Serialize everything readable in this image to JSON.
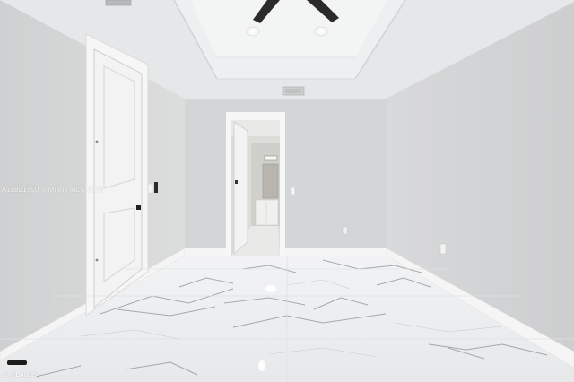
{
  "photo": {
    "watermark_text": "A11821750 © Miami MLS 2025",
    "brand_text": "SWFLAMLS"
  },
  "colors": {
    "wall": "#d6d7d8",
    "wall_shadow": "#c9cacb",
    "ceiling": "#e9eaeb",
    "trim": "#f7f7f7",
    "floor": "#eceef0",
    "marble_vein": "#8d8f93",
    "fan_blade": "#2b2b2b"
  },
  "icons": [
    "ceiling-fan-icon",
    "recessed-light-icon",
    "air-vent-icon",
    "door-handle-icon",
    "power-outlet-icon",
    "light-switch-icon"
  ]
}
